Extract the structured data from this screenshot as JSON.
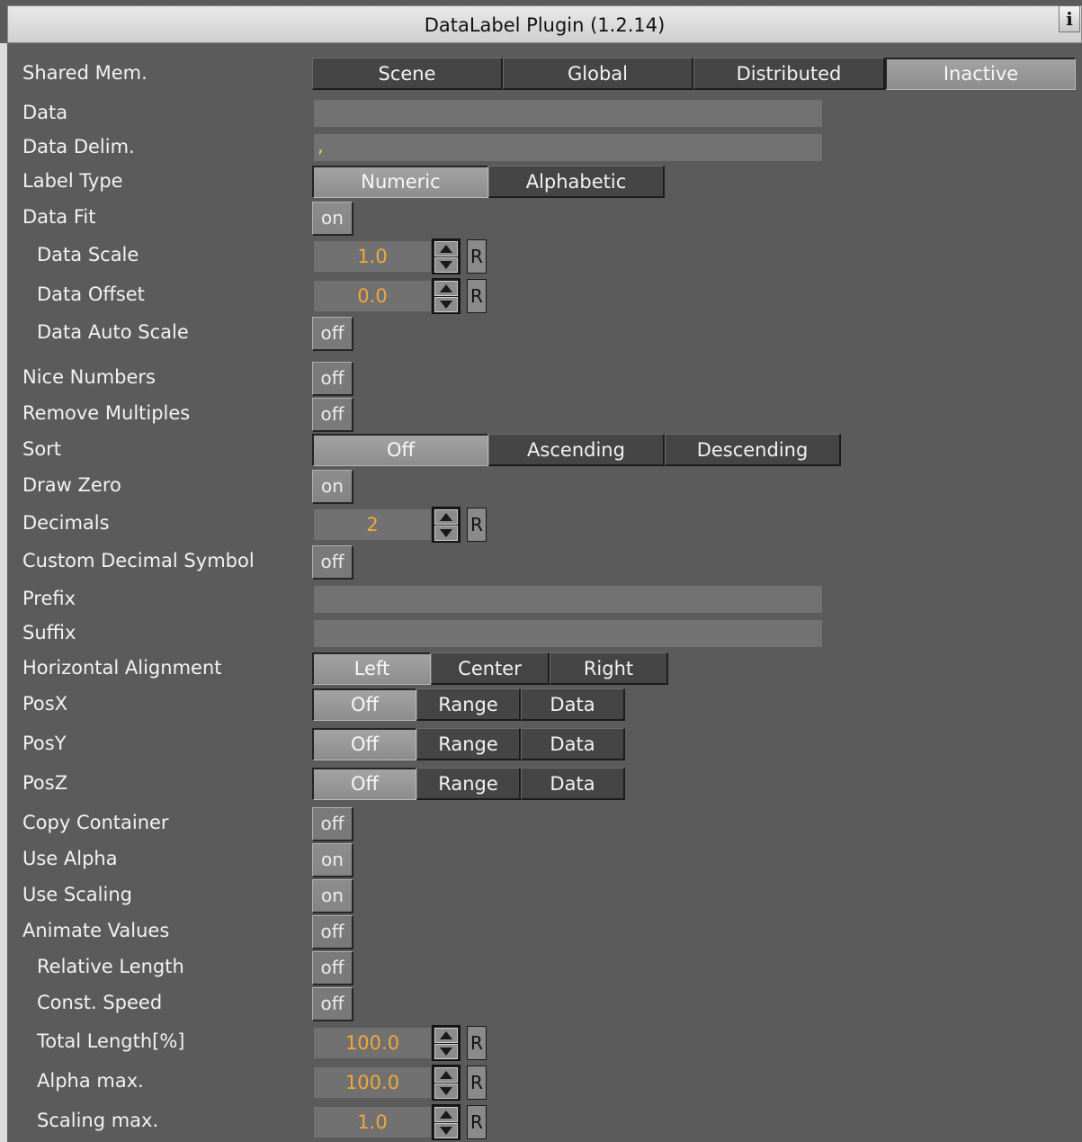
{
  "window": {
    "title": "DataLabel Plugin (1.2.14)",
    "info_glyph": "i"
  },
  "rows": {
    "shared_mem": {
      "label": "Shared Mem.",
      "options": [
        "Scene",
        "Global",
        "Distributed",
        "Inactive"
      ],
      "selected": "Inactive"
    },
    "data": {
      "label": "Data",
      "value": ""
    },
    "data_delim": {
      "label": "Data Delim.",
      "value": ","
    },
    "label_type": {
      "label": "Label Type",
      "options": [
        "Numeric",
        "Alphabetic"
      ],
      "selected": "Numeric"
    },
    "data_fit": {
      "label": "Data Fit",
      "value": "on"
    },
    "data_scale": {
      "label": "Data Scale",
      "value": "1.0",
      "reset": "R"
    },
    "data_offset": {
      "label": "Data Offset",
      "value": "0.0",
      "reset": "R"
    },
    "data_auto_scale": {
      "label": "Data Auto Scale",
      "value": "off"
    },
    "nice_numbers": {
      "label": "Nice Numbers",
      "value": "off"
    },
    "remove_multiples": {
      "label": "Remove Multiples",
      "value": "off"
    },
    "sort": {
      "label": "Sort",
      "options": [
        "Off",
        "Ascending",
        "Descending"
      ],
      "selected": "Off"
    },
    "draw_zero": {
      "label": "Draw Zero",
      "value": "on"
    },
    "decimals": {
      "label": "Decimals",
      "value": "2",
      "reset": "R"
    },
    "custom_decimal_symbol": {
      "label": "Custom Decimal Symbol",
      "value": "off"
    },
    "prefix": {
      "label": "Prefix",
      "value": ""
    },
    "suffix": {
      "label": "Suffix",
      "value": ""
    },
    "horizontal_alignment": {
      "label": "Horizontal Alignment",
      "options": [
        "Left",
        "Center",
        "Right"
      ],
      "selected": "Left"
    },
    "posx": {
      "label": "PosX",
      "options": [
        "Off",
        "Range",
        "Data"
      ],
      "selected": "Off"
    },
    "posy": {
      "label": "PosY",
      "options": [
        "Off",
        "Range",
        "Data"
      ],
      "selected": "Off"
    },
    "posz": {
      "label": "PosZ",
      "options": [
        "Off",
        "Range",
        "Data"
      ],
      "selected": "Off"
    },
    "copy_container": {
      "label": "Copy Container",
      "value": "off"
    },
    "use_alpha": {
      "label": "Use Alpha",
      "value": "on"
    },
    "use_scaling": {
      "label": "Use Scaling",
      "value": "on"
    },
    "animate_values": {
      "label": "Animate Values",
      "value": "off"
    },
    "relative_length": {
      "label": "Relative Length",
      "value": "off"
    },
    "const_speed": {
      "label": "Const. Speed",
      "value": "off"
    },
    "total_length": {
      "label": "Total Length[%]",
      "value": "100.0",
      "reset": "R"
    },
    "alpha_max": {
      "label": "Alpha max.",
      "value": "100.0",
      "reset": "R"
    },
    "scaling_max": {
      "label": "Scaling max.",
      "value": "1.0",
      "reset": "R"
    }
  },
  "colors": {
    "background": "#5b5b5b",
    "value_text": "#f0a73c",
    "selected_segment": "#999999",
    "unselected_segment": "#454545"
  }
}
